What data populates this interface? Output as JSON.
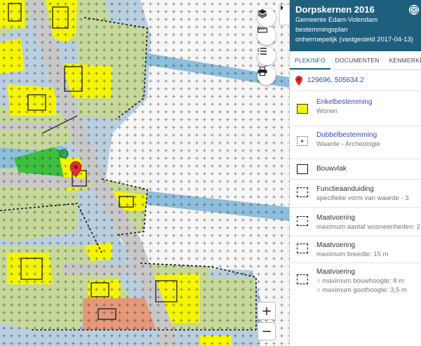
{
  "panel": {
    "title": "Dorpskernen 2016",
    "municipality": "Gemeente Edam-Volendam",
    "plan_type": "bestemmingsplan",
    "status": "onherroepelijk (vastgesteld 2017-04-13)",
    "tabs": [
      {
        "label": "PLEKINFO",
        "active": true
      },
      {
        "label": "DOCUMENTEN",
        "active": false
      },
      {
        "label": "KENMERKEN",
        "active": false
      }
    ],
    "coordinates": "129696, 505634.2",
    "entries": [
      {
        "title": "Enkelbestemming",
        "subtitle": "Wonen",
        "swatch": "yellow-fill"
      },
      {
        "title": "Dubbelbestemming",
        "subtitle": "Waarde - Archeologie",
        "swatch": "dotted-square"
      },
      {
        "title": "Bouwvlak",
        "subtitle": "",
        "swatch": "solid-square"
      },
      {
        "title": "Functieaanduiding",
        "subtitle": "specifieke vorm van waarde - 3",
        "swatch": "dashed-square"
      },
      {
        "title": "Maatvoering",
        "subtitle": "maximum aantal wooneenheden: 2",
        "swatch": "dashed-square"
      },
      {
        "title": "Maatvoering",
        "subtitle": "maximum breedte: 15 m",
        "swatch": "dashed-square"
      },
      {
        "title": "Maatvoering",
        "subtitles": [
          "maximum bouwhoogte: 8 m",
          "maximum goothoogte: 3,5 m"
        ],
        "swatch": "dashed-square"
      }
    ]
  },
  "map": {
    "zoom_in_label": "+",
    "zoom_out_label": "−",
    "controls": [
      "layers-icon",
      "ruler-icon",
      "legend-list-icon",
      "print-icon"
    ]
  },
  "colors": {
    "header": "#1f5f7e",
    "link": "#3a44c8",
    "coords": "#1a4fb0",
    "wonen_yellow": "#f5f500",
    "green_zone": "#c6d89a",
    "water": "#8ebedd",
    "road": "#c8c8c8",
    "park_green": "#3fbf3f",
    "special_orange": "#e5987a",
    "marker_red": "#e03030"
  }
}
